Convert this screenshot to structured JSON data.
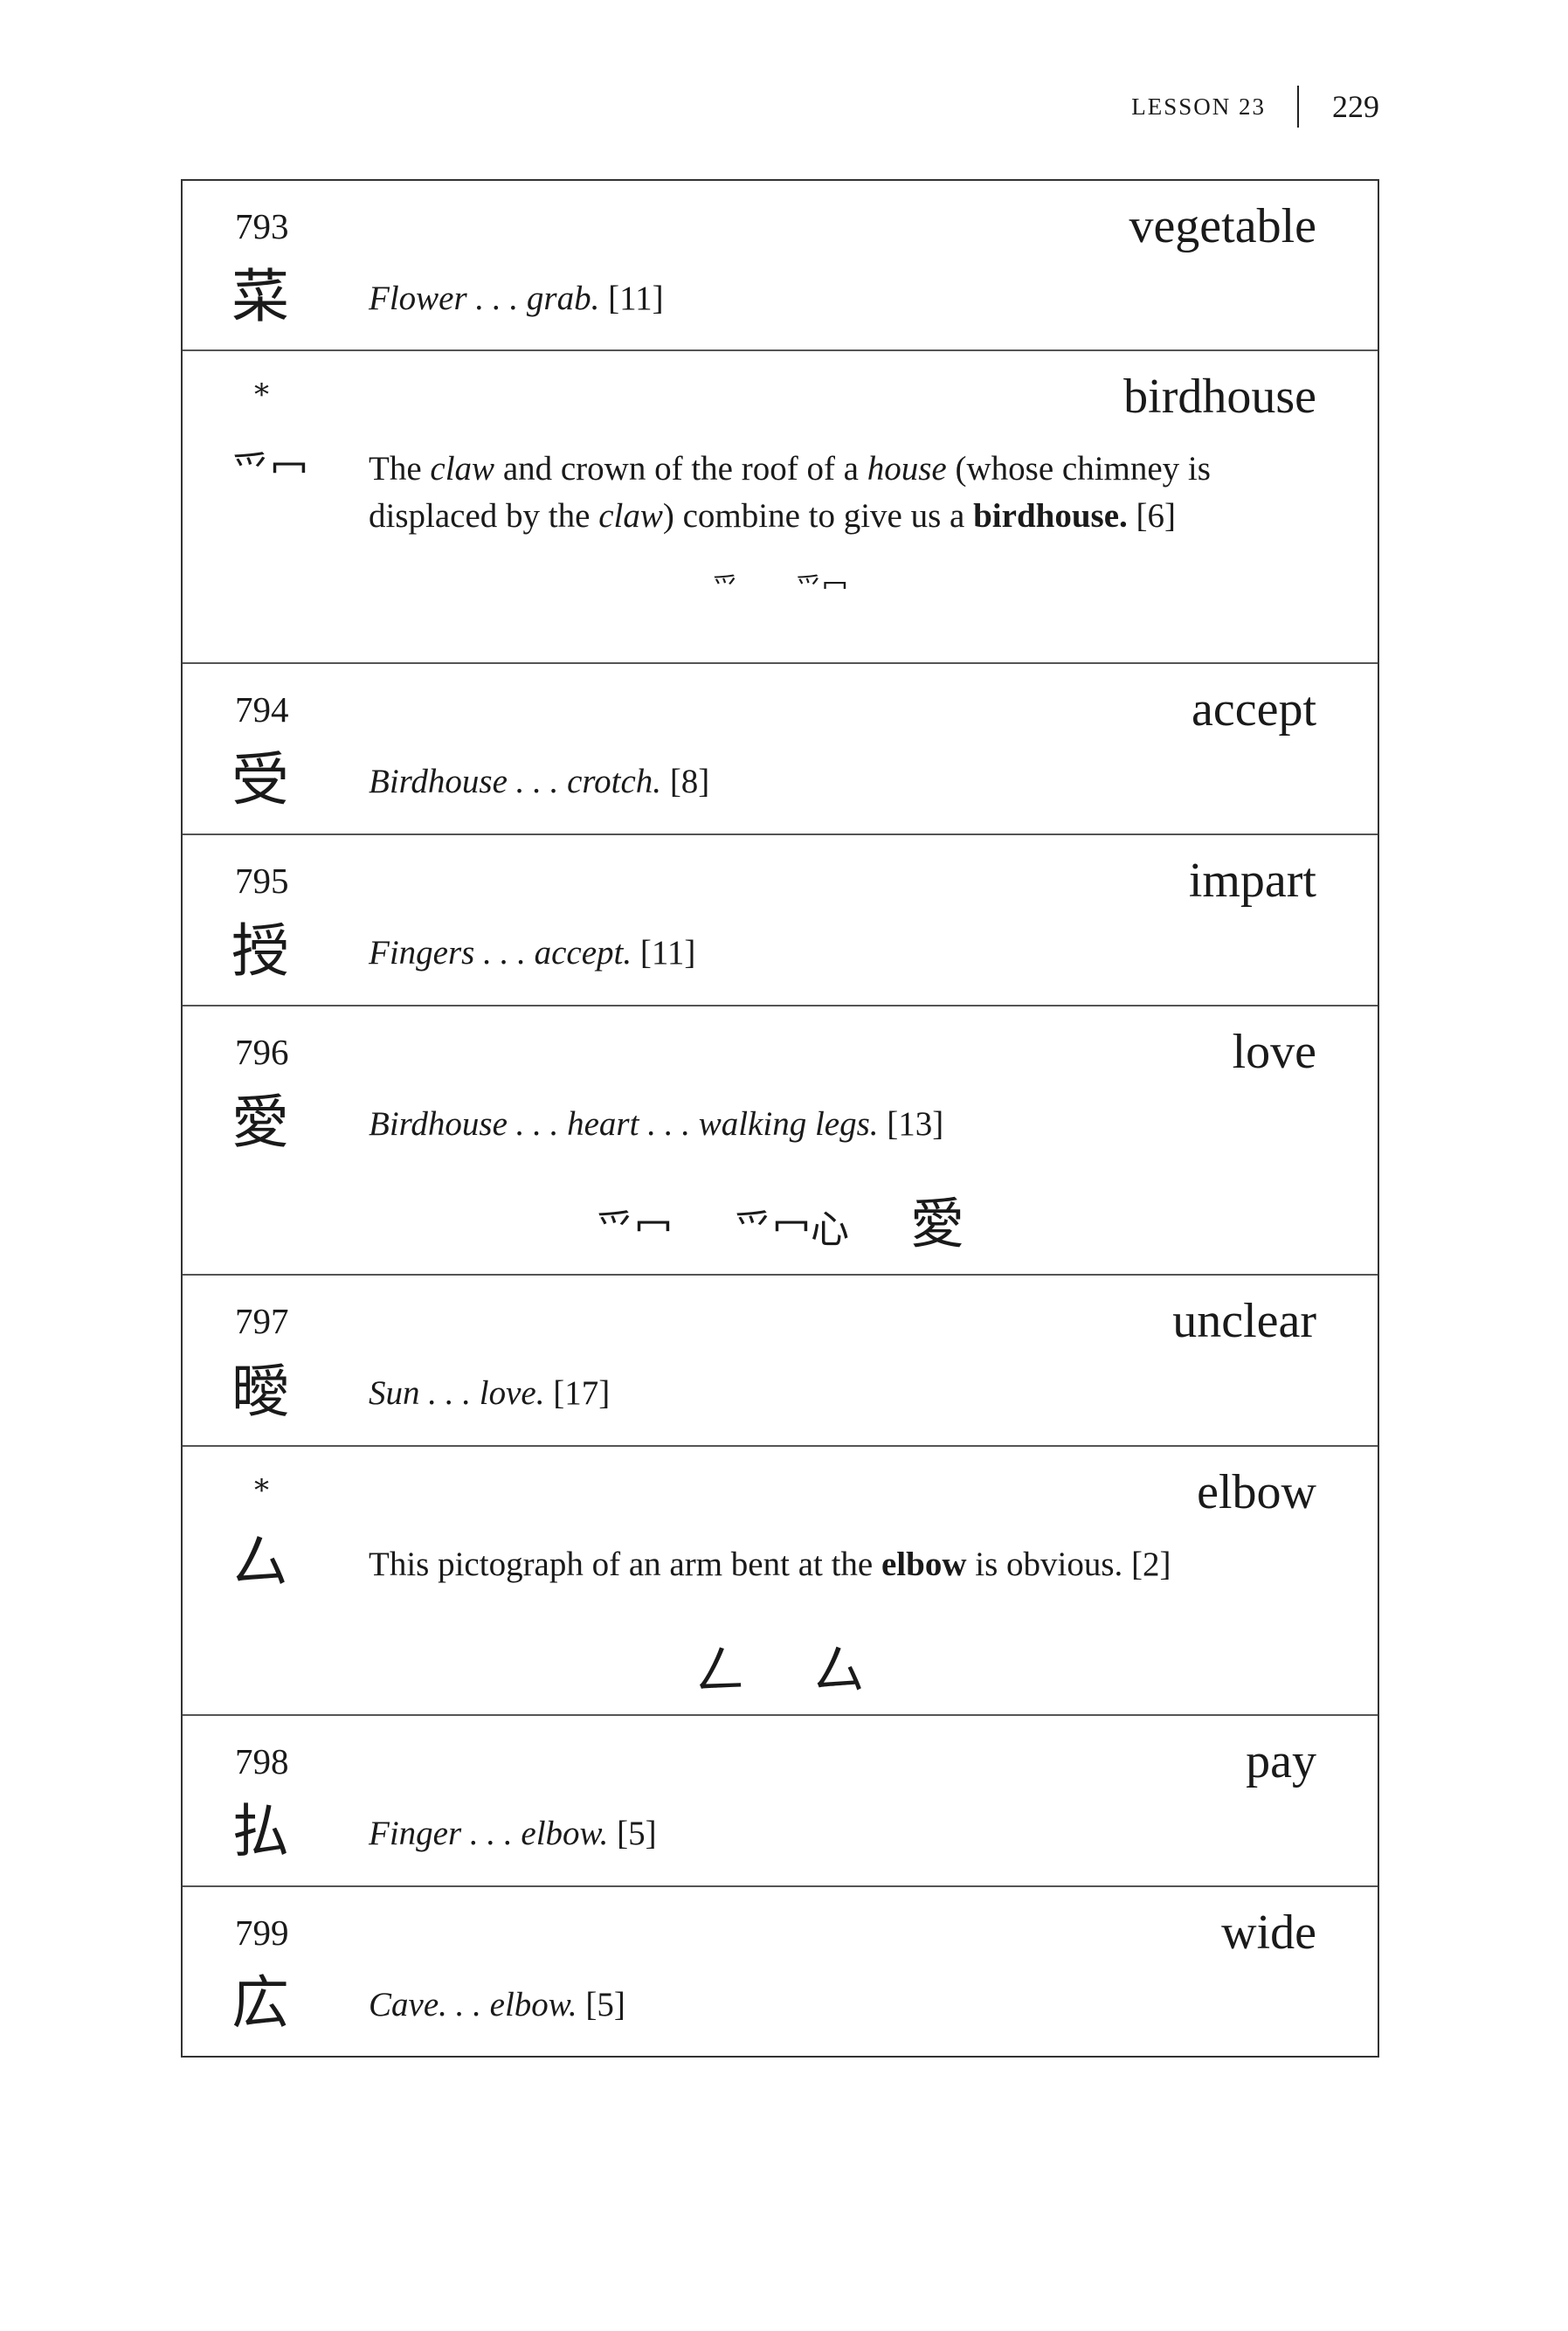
{
  "header": {
    "lesson": "LESSON 23",
    "page": "229"
  },
  "entries": [
    {
      "number": "793",
      "kanji": "菜",
      "keyword": "vegetable",
      "story": [
        "Flower . . . grab.",
        "[11]"
      ]
    },
    {
      "number": "*",
      "kanji": "爫冖",
      "keyword": "birdhouse",
      "story": [
        "The ",
        "claw",
        " and crown of the roof of a ",
        "house",
        " (whose chimney is displaced by the ",
        "claw",
        ") combine to give us a ",
        "birdhouse.",
        " [6]"
      ],
      "strokes": [
        "爫",
        "爫冖"
      ]
    },
    {
      "number": "794",
      "kanji": "受",
      "keyword": "accept",
      "story": [
        "Birdhouse . . . crotch.",
        "[8]"
      ]
    },
    {
      "number": "795",
      "kanji": "授",
      "keyword": "impart",
      "story": [
        "Fingers . . . accept.",
        "[11]"
      ]
    },
    {
      "number": "796",
      "kanji": "愛",
      "keyword": "love",
      "story": [
        "Birdhouse . . . heart . . . walking legs.",
        "[13]"
      ],
      "strokes": [
        "爫冖",
        "爫冖心",
        "愛"
      ]
    },
    {
      "number": "797",
      "kanji": "曖",
      "keyword": "unclear",
      "story": [
        "Sun . . . love.",
        "[17]"
      ]
    },
    {
      "number": "*",
      "kanji": "厶",
      "keyword": "elbow",
      "story": [
        "This pictograph of an arm bent at the ",
        "elbow",
        " is obvious. [2]"
      ],
      "strokes": [
        "𠃋",
        "厶"
      ]
    },
    {
      "number": "798",
      "kanji": "払",
      "keyword": "pay",
      "story": [
        "Finger . . . elbow.",
        "[5]"
      ]
    },
    {
      "number": "799",
      "kanji": "広",
      "keyword": "wide",
      "story": [
        "Cave. . . elbow.",
        "[5]"
      ]
    }
  ]
}
